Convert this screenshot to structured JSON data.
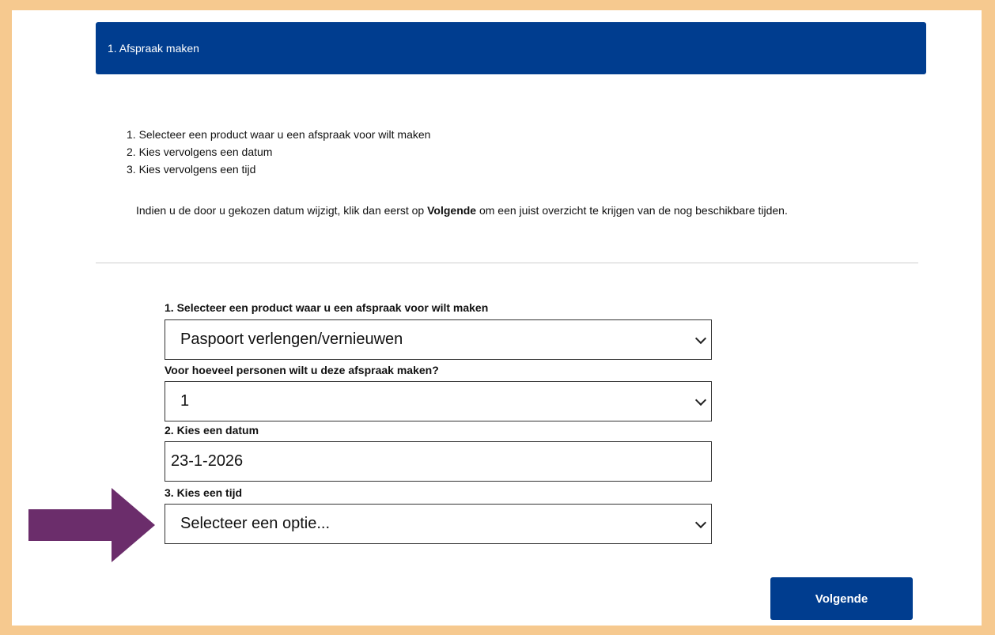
{
  "header": {
    "title": "1. Afspraak maken"
  },
  "instructions": {
    "steps": [
      "1. Selecteer een product waar u een afspraak voor wilt maken",
      "2. Kies vervolgens een datum",
      "3. Kies vervolgens een tijd"
    ],
    "info_before": "Indien u de door u gekozen datum wijzigt, klik dan eerst op ",
    "info_bold": "Volgende",
    "info_after": " om een juist overzicht te krijgen van de nog beschikbare tijden."
  },
  "form": {
    "product": {
      "label": "1. Selecteer een product waar u een afspraak voor wilt maken",
      "value": "Paspoort verlengen/vernieuwen"
    },
    "persons": {
      "label": "Voor hoeveel personen wilt u deze afspraak maken?",
      "value": "1"
    },
    "date": {
      "label": "2. Kies een datum",
      "value": "23-1-2026"
    },
    "time": {
      "label": "3. Kies een tijd",
      "value": "Selecteer een optie..."
    }
  },
  "actions": {
    "next_label": "Volgende"
  },
  "colors": {
    "primary": "#003d8f",
    "frame": "#f6c98f",
    "arrow": "#6b2d6b"
  },
  "icons": {
    "select_indicator": "chevron-down-icon",
    "pointer": "arrow-right-icon"
  }
}
